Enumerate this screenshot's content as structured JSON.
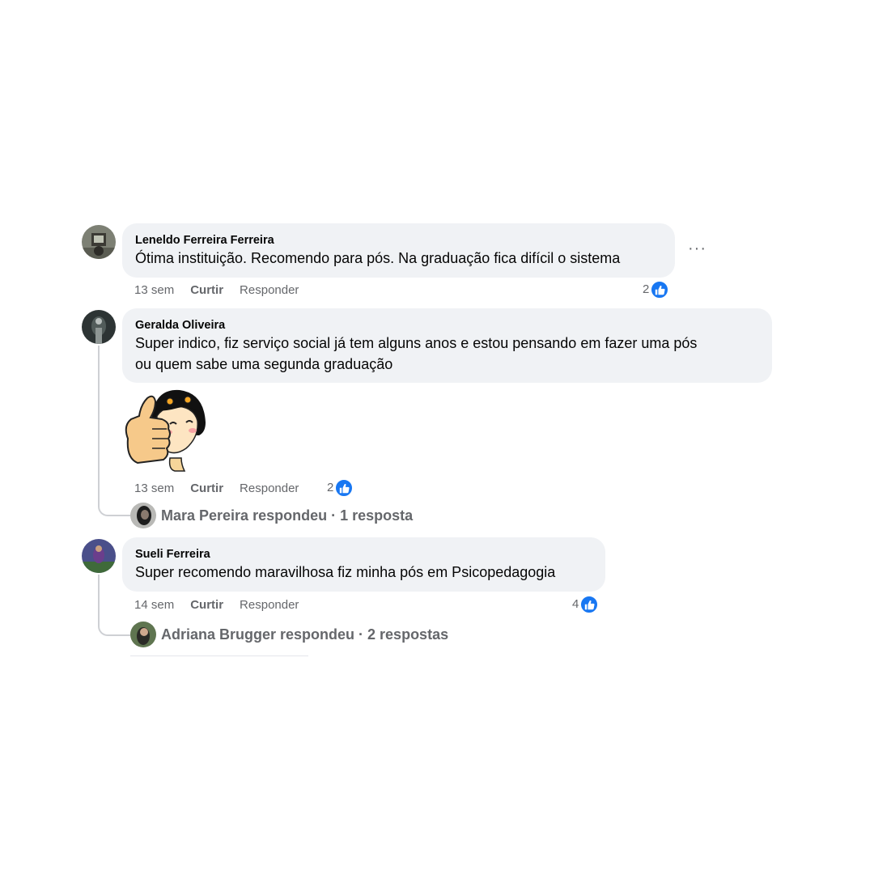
{
  "comments": [
    {
      "author": "Leneldo Ferreira Ferreira",
      "text": "Ótima instituição. Recomendo para pós. Na graduação fica difícil o sistema",
      "time": "13 sem",
      "like_label": "Curtir",
      "reply_label": "Responder",
      "reactions": "2"
    },
    {
      "author": "Geralda Oliveira",
      "text_line1": "Super indico, fiz serviço social já tem alguns anos e estou pensando em fazer uma pós",
      "text_line2": "ou quem sabe uma segunda graduação",
      "time": "13 sem",
      "like_label": "Curtir",
      "reply_label": "Responder",
      "reactions": "2",
      "replies_label": "Mara Pereira respondeu · 1 resposta"
    },
    {
      "author": "Sueli Ferreira",
      "text": "Super recomendo maravilhosa fiz minha pós em Psicopedagogia",
      "time": "14 sem",
      "like_label": "Curtir",
      "reply_label": "Responder",
      "reactions": "4",
      "replies_label": "Adriana Brugger respondeu · 2 respostas"
    }
  ],
  "more_options": "···",
  "colors": {
    "bubble": "#f0f2f5",
    "meta_text": "#65676b",
    "like_blue": "#1877f2",
    "thread_line": "#ced0d4"
  }
}
